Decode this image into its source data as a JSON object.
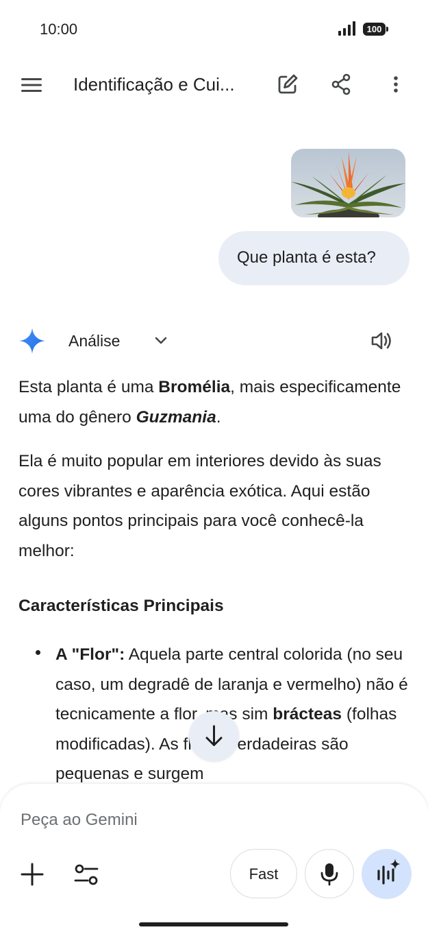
{
  "status_bar": {
    "time": "10:00",
    "battery": "100"
  },
  "app_bar": {
    "title": "Identificação e Cui...",
    "icons": [
      "menu-icon",
      "edit-icon",
      "share-icon",
      "more-vert-icon"
    ]
  },
  "user_message": {
    "text": "Que planta é esta?"
  },
  "response": {
    "header_label": "Análise",
    "p1_a": "Esta planta é uma ",
    "p1_b": "Bromélia",
    "p1_c": ", mais especificamente uma do gênero ",
    "p1_d": "Guzmania",
    "p1_e": ".",
    "p2": "Ela é muito popular em interiores devido às suas cores vibrantes e aparência exótica. Aqui estão alguns pontos principais para você conhecê-la melhor:",
    "section_heading": "Características Principais",
    "bullet1_label": "A \"Flor\":",
    "bullet1_a": " Aquela parte central colorida (no seu caso, um degradê de laranja e vermelho) não é tecnicamente a flor, mas sim ",
    "bullet1_b": "brácteas",
    "bullet1_c": " (folhas modificadas). As flores verdadeiras são pequenas e surgem"
  },
  "composer": {
    "placeholder": "Peça ao Gemini",
    "mode_label": "Fast"
  },
  "colors": {
    "bubble": "#e9eef6",
    "live_button": "#d3e3fd",
    "gemini_star": "#4285f4"
  }
}
